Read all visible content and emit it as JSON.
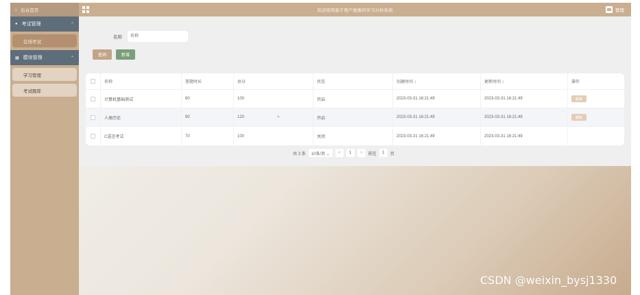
{
  "sidebar": {
    "home": "后台首页",
    "groups": [
      {
        "label": "考试管理",
        "items": [
          {
            "label": "在线考试",
            "active": true
          }
        ]
      },
      {
        "label": "模块管理",
        "items": [
          {
            "label": "学习管理",
            "active": false
          },
          {
            "label": "考试题库",
            "active": false
          }
        ]
      }
    ]
  },
  "topbar": {
    "title": "欢迎使用基于用户画像的学习分析系统",
    "username": "管理"
  },
  "search": {
    "label": "名称",
    "placeholder": "名称",
    "query_button": "查询",
    "add_button": "新增"
  },
  "table": {
    "columns": [
      "名称",
      "答题时长",
      "总分",
      "状态",
      "创建时间 ↕",
      "更新时间 ↕",
      "操作"
    ],
    "rows": [
      {
        "name": "计算机基础测试",
        "duration": "60",
        "score": "100",
        "status": "开启",
        "created": "2023-03-31 16:21:49",
        "updated": "2023-03-31 16:21:49",
        "op": "删除"
      },
      {
        "name": "人类历史",
        "duration": "90",
        "score": "120",
        "status": "开启",
        "created": "2023-03-31 16:21:49",
        "updated": "2023-03-31 16:21:49",
        "op": "删除"
      },
      {
        "name": "C语言考试",
        "duration": "70",
        "score": "100",
        "status": "关闭",
        "created": "2023-03-31 16:21:49",
        "updated": "2023-03-31 16:21:49",
        "op": ""
      }
    ]
  },
  "pager": {
    "total": "共 3 条",
    "page_size": "10条/页 ⌄",
    "prev": "<",
    "current": "1",
    "next": ">",
    "goto": "前往",
    "goto_value": "1",
    "unit": "页"
  },
  "watermark": "CSDN @weixin_bysj1330",
  "colors": {
    "accent": "#c9ae8f",
    "sidebar_group": "#5e6d7a",
    "add": "#7a9f77"
  }
}
